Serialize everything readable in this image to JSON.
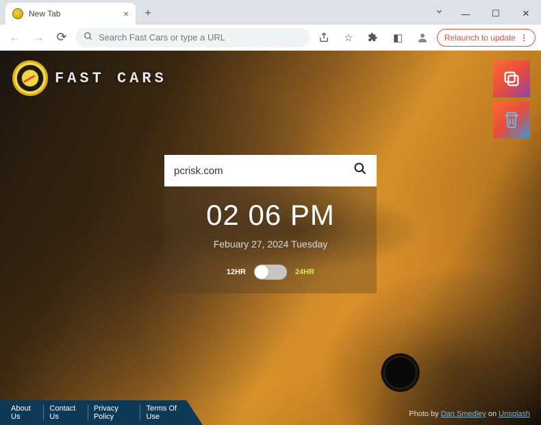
{
  "browser": {
    "tab_title": "New Tab",
    "omnibox_placeholder": "Search Fast Cars or type a URL",
    "relaunch_label": "Relaunch to update"
  },
  "brand": {
    "title": "FAST CARS"
  },
  "side": {
    "duplicate_icon": "duplicate-icon",
    "trash_icon": "trash-icon"
  },
  "search": {
    "value": "pcrisk.com"
  },
  "clock": {
    "time": "02 06 PM",
    "date": "Febuary 27, 2024  Tuesday"
  },
  "toggle": {
    "left": "12HR",
    "right": "24HR"
  },
  "footer": {
    "links": {
      "about": "About Us",
      "contact": "Contact Us",
      "privacy": "Privacy Policy",
      "terms": "Terms Of Use"
    },
    "credit_prefix": "Photo by ",
    "credit_author": "Dan Smedley",
    "credit_middle": " on ",
    "credit_site": "Unsplash"
  }
}
